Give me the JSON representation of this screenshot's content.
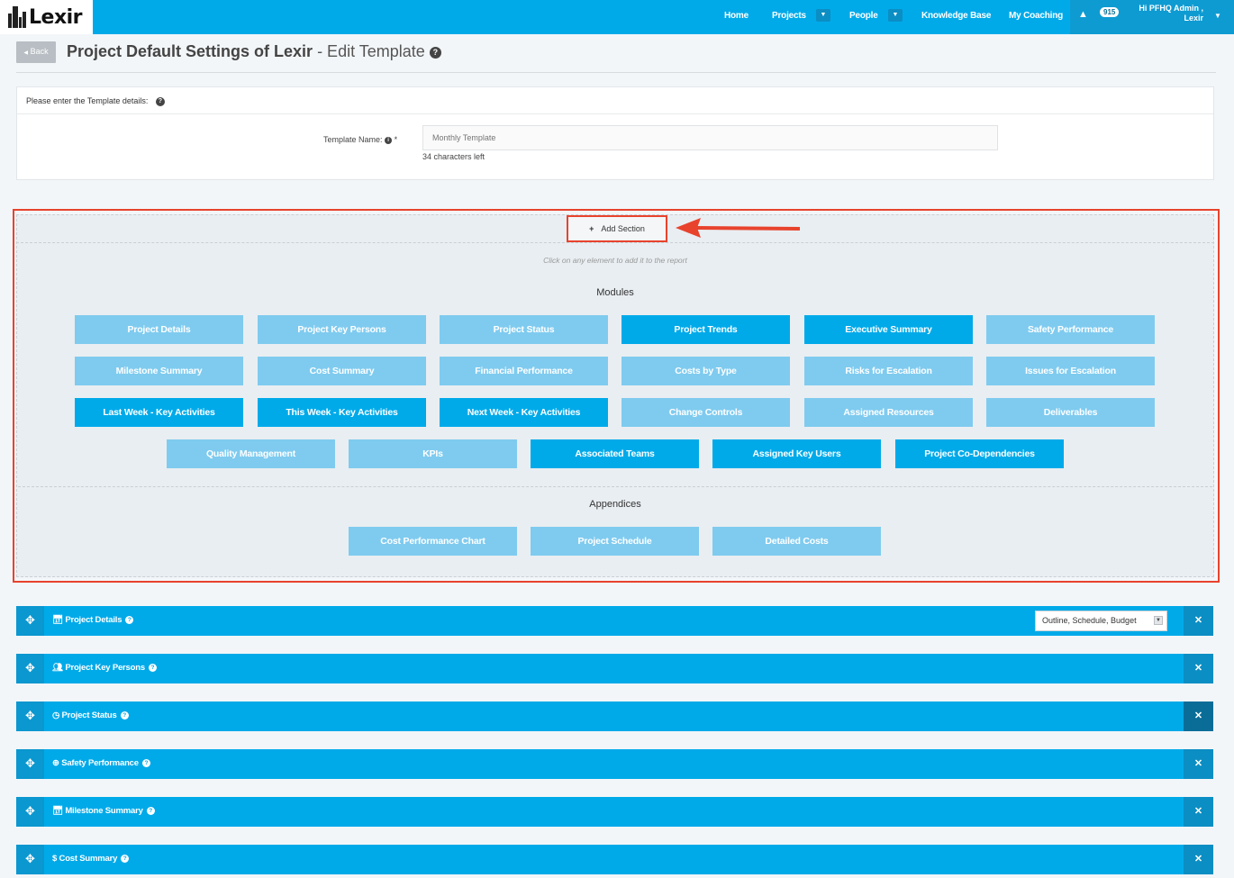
{
  "brand": {
    "name": "Lexir"
  },
  "nav": {
    "items": [
      "Home",
      "Projects",
      "People",
      "Knowledge Base",
      "My Coaching"
    ],
    "alert_count": "915",
    "user_line1": "Hi PFHQ Admin ,",
    "user_line2": "Lexir"
  },
  "header": {
    "back_label": "Back",
    "title_bold": "Project Default Settings of Lexir",
    "title_sub": " - Edit Template"
  },
  "template_card": {
    "heading": "Please enter the Template details:",
    "name_label": "Template Name:",
    "name_placeholder": "Monthly Template",
    "chars_left": "34 characters left"
  },
  "add_section": {
    "button_label": "Add Section",
    "hint": "Click on any element to add it to the report",
    "modules_heading": "Modules",
    "appendices_heading": "Appendices",
    "modules": [
      {
        "label": "Project Details",
        "state": "light"
      },
      {
        "label": "Project Key Persons",
        "state": "light"
      },
      {
        "label": "Project Status",
        "state": "light"
      },
      {
        "label": "Project Trends",
        "state": "dark"
      },
      {
        "label": "Executive Summary",
        "state": "dark"
      },
      {
        "label": "Safety Performance",
        "state": "light"
      },
      {
        "label": "Milestone Summary",
        "state": "light"
      },
      {
        "label": "Cost Summary",
        "state": "light"
      },
      {
        "label": "Financial Performance",
        "state": "light"
      },
      {
        "label": "Costs by Type",
        "state": "light"
      },
      {
        "label": "Risks for Escalation",
        "state": "light"
      },
      {
        "label": "Issues for Escalation",
        "state": "light"
      },
      {
        "label": "Last Week - Key Activities",
        "state": "dark"
      },
      {
        "label": "This Week - Key Activities",
        "state": "dark"
      },
      {
        "label": "Next Week - Key Activities",
        "state": "dark"
      },
      {
        "label": "Change Controls",
        "state": "light"
      },
      {
        "label": "Assigned Resources",
        "state": "light"
      },
      {
        "label": "Deliverables",
        "state": "light"
      },
      {
        "label": "Quality Management",
        "state": "light"
      },
      {
        "label": "KPIs",
        "state": "light"
      },
      {
        "label": "Associated Teams",
        "state": "dark"
      },
      {
        "label": "Assigned Key Users",
        "state": "dark"
      },
      {
        "label": "Project Co-Dependencies",
        "state": "dark"
      }
    ],
    "appendices": [
      {
        "label": "Cost Performance Chart",
        "state": "light"
      },
      {
        "label": "Project Schedule",
        "state": "light"
      },
      {
        "label": "Detailed Costs",
        "state": "light"
      }
    ]
  },
  "sections": [
    {
      "title": "Project Details",
      "icon": "calendar-icon",
      "select_value": "Outline, Schedule, Budget"
    },
    {
      "title": "Project Key Persons",
      "icon": "users-icon"
    },
    {
      "title": "Project Status",
      "icon": "clock-icon"
    },
    {
      "title": "Safety Performance",
      "icon": "globe-icon"
    },
    {
      "title": "Milestone Summary",
      "icon": "calendar-icon"
    },
    {
      "title": "Cost Summary",
      "icon": "dollar-icon"
    }
  ],
  "colors": {
    "brand_blue": "#00aae9",
    "module_inactive": "#7fcbef",
    "highlight_red": "#e8432d"
  }
}
